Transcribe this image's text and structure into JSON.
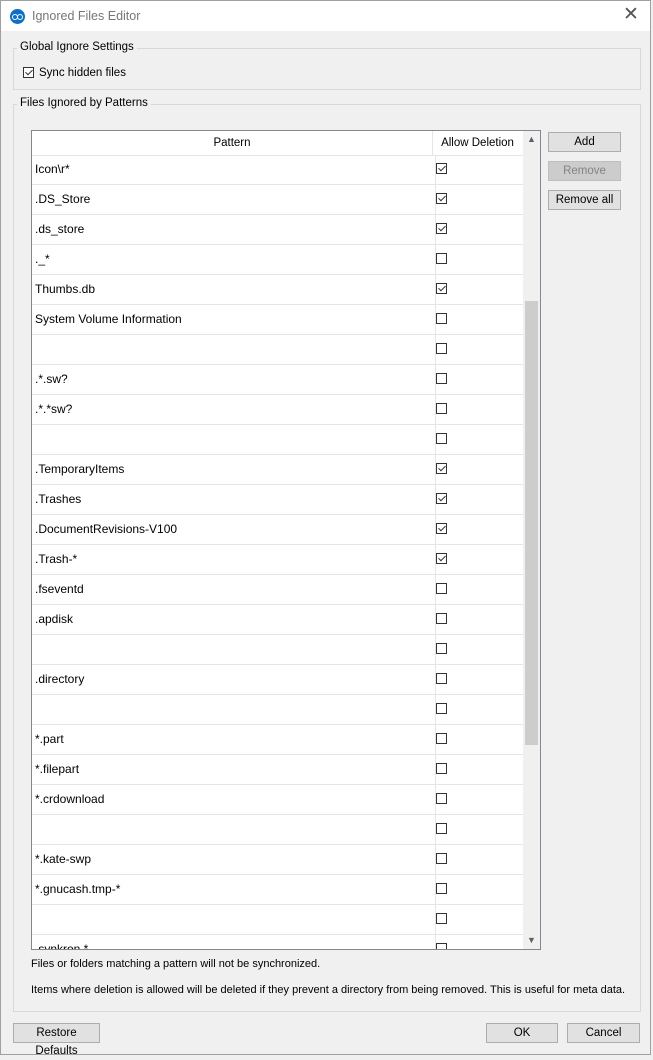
{
  "window": {
    "title": "Ignored Files Editor"
  },
  "global_group": {
    "title": "Global Ignore Settings",
    "sync_hidden_label": "Sync hidden files",
    "sync_hidden_checked": true
  },
  "patterns_group": {
    "title": "Files Ignored by Patterns"
  },
  "table": {
    "columns": [
      "Pattern",
      "Allow Deletion"
    ],
    "rows": [
      {
        "pattern": "Icon\\r*",
        "allow": true
      },
      {
        "pattern": ".DS_Store",
        "allow": true
      },
      {
        "pattern": ".ds_store",
        "allow": true
      },
      {
        "pattern": "._*",
        "allow": false
      },
      {
        "pattern": "Thumbs.db",
        "allow": true
      },
      {
        "pattern": "System Volume Information",
        "allow": false
      },
      {
        "pattern": "",
        "allow": false
      },
      {
        "pattern": ".*.sw?",
        "allow": false
      },
      {
        "pattern": ".*.*sw?",
        "allow": false
      },
      {
        "pattern": "",
        "allow": false
      },
      {
        "pattern": ".TemporaryItems",
        "allow": true
      },
      {
        "pattern": ".Trashes",
        "allow": true
      },
      {
        "pattern": ".DocumentRevisions-V100",
        "allow": true
      },
      {
        "pattern": ".Trash-*",
        "allow": true
      },
      {
        "pattern": ".fseventd",
        "allow": false
      },
      {
        "pattern": ".apdisk",
        "allow": false
      },
      {
        "pattern": "",
        "allow": false
      },
      {
        "pattern": ".directory",
        "allow": false
      },
      {
        "pattern": "",
        "allow": false
      },
      {
        "pattern": "*.part",
        "allow": false
      },
      {
        "pattern": "*.filepart",
        "allow": false
      },
      {
        "pattern": "*.crdownload",
        "allow": false
      },
      {
        "pattern": "",
        "allow": false
      },
      {
        "pattern": "*.kate-swp",
        "allow": false
      },
      {
        "pattern": "*.gnucash.tmp-*",
        "allow": false
      },
      {
        "pattern": "",
        "allow": false
      },
      {
        "pattern": ".synkron.*",
        "allow": false
      }
    ]
  },
  "buttons": {
    "add": "Add",
    "remove": "Remove",
    "remove_all": "Remove all",
    "restore": "Restore Defaults",
    "ok": "OK",
    "cancel": "Cancel"
  },
  "notes": {
    "line1": "Files or folders matching a pattern will not be synchronized.",
    "line2": "Items where deletion is allowed will be deleted if they prevent a directory from being removed. This is useful for meta data."
  }
}
